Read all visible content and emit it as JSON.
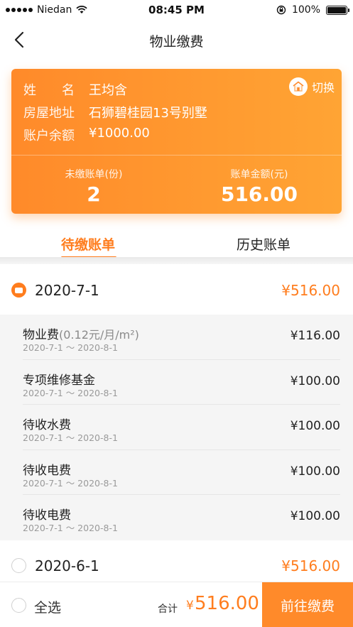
{
  "status_bar": {
    "carrier": "Niedan",
    "time": "08:45 PM",
    "battery": "100%"
  },
  "nav": {
    "title": "物业缴费"
  },
  "account": {
    "name_label": "姓　　名",
    "name": "王均含",
    "address_label": "房屋地址",
    "address": "石狮碧桂园13号别墅",
    "balance_label": "账户余额",
    "balance": "¥1000.00",
    "switch_label": "切换",
    "unpaid_label": "未缴账单(份)",
    "unpaid_count": "2",
    "amount_label": "账单金额(元)",
    "amount": "516.00"
  },
  "tabs": {
    "pending": "待缴账单",
    "history": "历史账单"
  },
  "bills": [
    {
      "date": "2020-7-1",
      "total": "¥516.00",
      "selected": true,
      "items": [
        {
          "name": "物业费",
          "note": "(0.12元/月/m²)",
          "period": "2020-7-1 ～ 2020-8-1",
          "amount": "¥116.00"
        },
        {
          "name": "专项维修基金",
          "note": "",
          "period": "2020-7-1 ～ 2020-8-1",
          "amount": "¥100.00"
        },
        {
          "name": "待收水费",
          "note": "",
          "period": "2020-7-1 ～ 2020-8-1",
          "amount": "¥100.00"
        },
        {
          "name": "待收电费",
          "note": "",
          "period": "2020-7-1 ～ 2020-8-1",
          "amount": "¥100.00"
        },
        {
          "name": "待收电费",
          "note": "",
          "period": "2020-7-1 ～ 2020-8-1",
          "amount": "¥100.00"
        }
      ]
    },
    {
      "date": "2020-6-1",
      "total": "¥516.00",
      "selected": false
    }
  ],
  "footer": {
    "select_all": "全选",
    "sum_label": "合计",
    "sum_currency": "¥",
    "sum_value": "516.00",
    "pay_button": "前往缴费"
  },
  "colors": {
    "accent": "#ff7d1e",
    "card_gradient_start": "#ff8a2a",
    "card_gradient_end": "#ffa434",
    "items_background": "#f5f5f5"
  }
}
